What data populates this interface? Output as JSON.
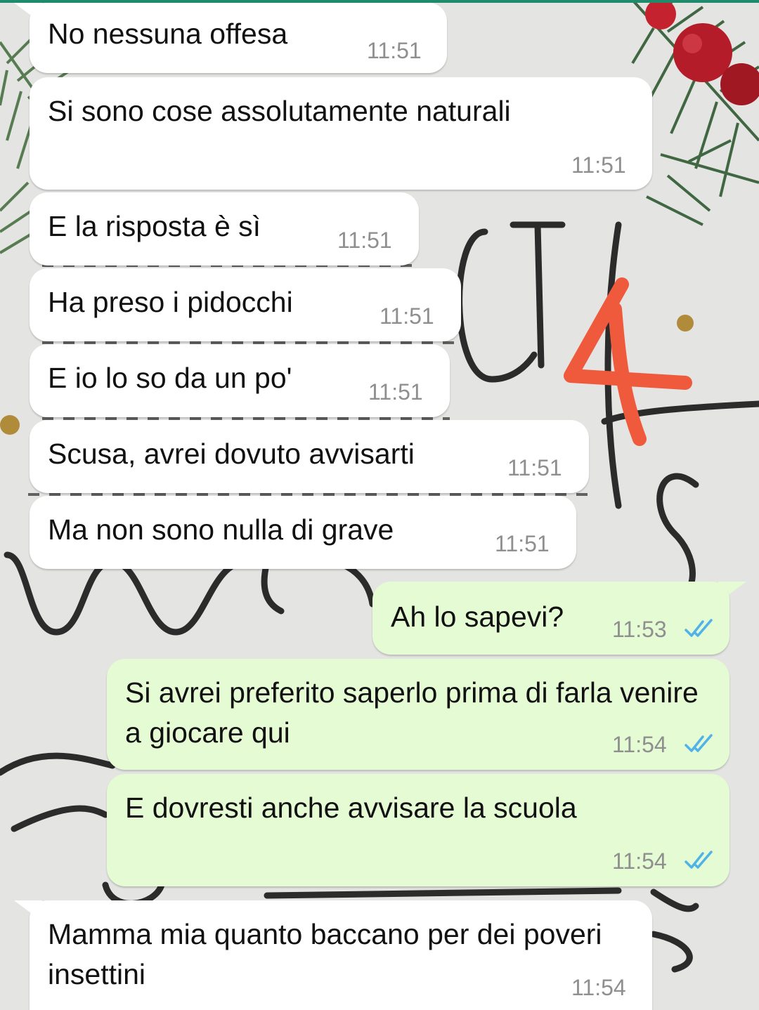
{
  "chat": {
    "messages": [
      {
        "id": "m1",
        "direction": "incoming",
        "text": "No nessuna offesa",
        "time": "11:51"
      },
      {
        "id": "m2",
        "direction": "incoming",
        "text": "Si sono cose assolutamente naturali",
        "time": "11:51"
      },
      {
        "id": "m3",
        "direction": "incoming",
        "text": "E la risposta è sì",
        "time": "11:51"
      },
      {
        "id": "m4",
        "direction": "incoming",
        "text": "Ha preso i pidocchi",
        "time": "11:51"
      },
      {
        "id": "m5",
        "direction": "incoming",
        "text": "E io lo so da un po'",
        "time": "11:51"
      },
      {
        "id": "m6",
        "direction": "incoming",
        "text": "Scusa, avrei dovuto avvisarti",
        "time": "11:51"
      },
      {
        "id": "m7",
        "direction": "incoming",
        "text": "Ma non sono nulla di grave",
        "time": "11:51"
      },
      {
        "id": "m8",
        "direction": "outgoing",
        "text": "Ah lo sapevi?",
        "time": "11:53",
        "status": "read-double-check-icon"
      },
      {
        "id": "m9",
        "direction": "outgoing",
        "text": "Si avrei preferito saperlo prima di farla venire a giocare qui",
        "time": "11:54",
        "status": "read-double-check-icon"
      },
      {
        "id": "m10",
        "direction": "outgoing",
        "text": "E dovresti anche avvisare la scuola",
        "time": "11:54",
        "status": "read-double-check-icon"
      },
      {
        "id": "m11",
        "direction": "incoming",
        "text": "Mamma mia quanto baccano per dei poveri insettini",
        "time": "11:54"
      }
    ]
  },
  "overlay": {
    "annotation_number": "4",
    "annotation_color": "#f05a3c"
  },
  "colors": {
    "incoming_bubble": "#ffffff",
    "outgoing_bubble": "#e5fbd4",
    "timestamp": "#8f8f8f",
    "read_ticks": "#4fb3e8",
    "header_accent": "#1f8a6c"
  }
}
